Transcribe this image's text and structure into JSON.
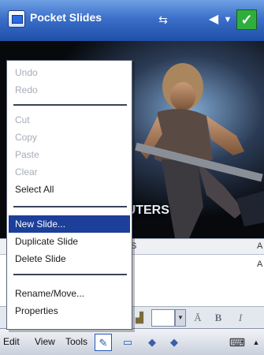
{
  "app": {
    "title": "Pocket Slides"
  },
  "status_icons": {
    "connectivity": "connectivity-icon",
    "volume": "speaker-icon",
    "signal": "signal-icon",
    "ok_label": "✓"
  },
  "slide": {
    "caption": "PUTERS"
  },
  "notes": {
    "col_left": "S",
    "col_right": "A",
    "row_marker": "A"
  },
  "format_toolbar": {
    "bold_label": "B",
    "italic_label": "I"
  },
  "edit_menu": {
    "items": [
      {
        "label": "Undo",
        "enabled": false
      },
      {
        "label": "Redo",
        "enabled": false
      },
      {
        "label": "Cut",
        "enabled": false
      },
      {
        "label": "Copy",
        "enabled": false
      },
      {
        "label": "Paste",
        "enabled": false
      },
      {
        "label": "Clear",
        "enabled": false
      },
      {
        "label": "Select All",
        "enabled": true
      },
      {
        "label": "New Slide...",
        "enabled": true,
        "selected": true
      },
      {
        "label": "Duplicate Slide",
        "enabled": true
      },
      {
        "label": "Delete Slide",
        "enabled": true
      },
      {
        "label": "Rename/Move...",
        "enabled": true
      },
      {
        "label": "Properties",
        "enabled": true
      }
    ]
  },
  "menubar": {
    "edit": "Edit",
    "view": "View",
    "tools": "Tools"
  },
  "colors": {
    "titlebar": "#3b6fc9",
    "menu_highlight": "#1c3f9a",
    "ok_button": "#2fae3d"
  }
}
